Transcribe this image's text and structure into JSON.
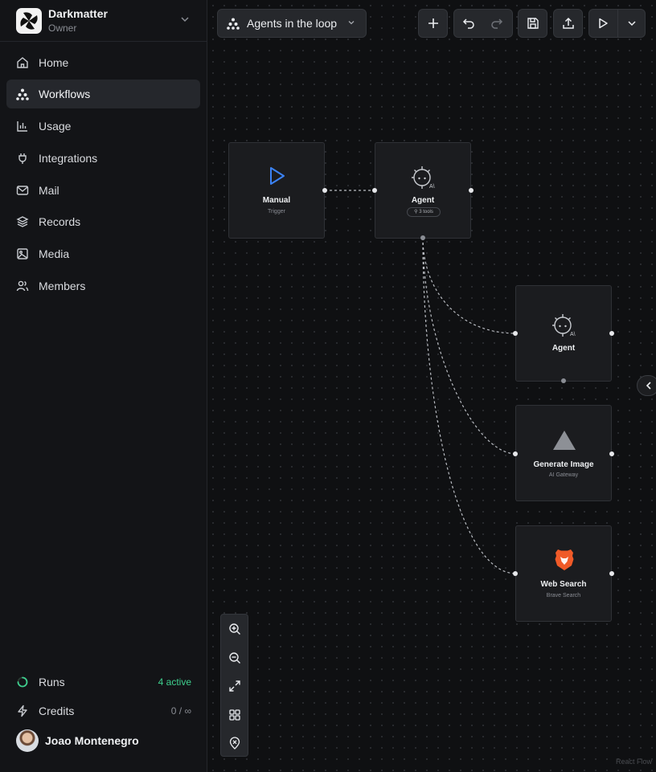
{
  "workspace": {
    "name": "Darkmatter",
    "role": "Owner"
  },
  "nav": [
    {
      "label": "Home",
      "icon": "home-icon"
    },
    {
      "label": "Workflows",
      "icon": "workflow-icon",
      "active": true
    },
    {
      "label": "Usage",
      "icon": "bar-chart-icon"
    },
    {
      "label": "Integrations",
      "icon": "plug-icon"
    },
    {
      "label": "Mail",
      "icon": "mail-icon"
    },
    {
      "label": "Records",
      "icon": "layers-icon"
    },
    {
      "label": "Media",
      "icon": "image-icon"
    },
    {
      "label": "Members",
      "icon": "users-icon"
    }
  ],
  "footer": {
    "runs": {
      "label": "Runs",
      "value": "4 active",
      "color": "#3ecf8e"
    },
    "credits": {
      "label": "Credits",
      "value": "0 / ∞"
    },
    "user": {
      "name": "Joao Montenegro"
    }
  },
  "toolbar": {
    "workflow_title": "Agents in the loop",
    "buttons": [
      "add-icon",
      "undo-icon",
      "redo-icon",
      "save-icon",
      "upload-icon",
      "play-icon",
      "chevron-down-icon"
    ]
  },
  "nodes": {
    "manual": {
      "title": "Manual",
      "subtitle": "Trigger"
    },
    "agent_main": {
      "title": "Agent",
      "badge": "3 tools"
    },
    "agent_sub": {
      "title": "Agent"
    },
    "generate_image": {
      "title": "Generate Image",
      "subtitle": "AI Gateway"
    },
    "web_search": {
      "title": "Web Search",
      "subtitle": "Brave Search"
    }
  },
  "zoom_controls": [
    "zoom-in-icon",
    "zoom-out-icon",
    "fit-view-icon",
    "grid-icon",
    "location-icon"
  ],
  "attribution": "React Flow",
  "colors": {
    "accent_blue": "#3b82f6",
    "brave_orange": "#f05a28",
    "active_green": "#3ecf8e"
  }
}
